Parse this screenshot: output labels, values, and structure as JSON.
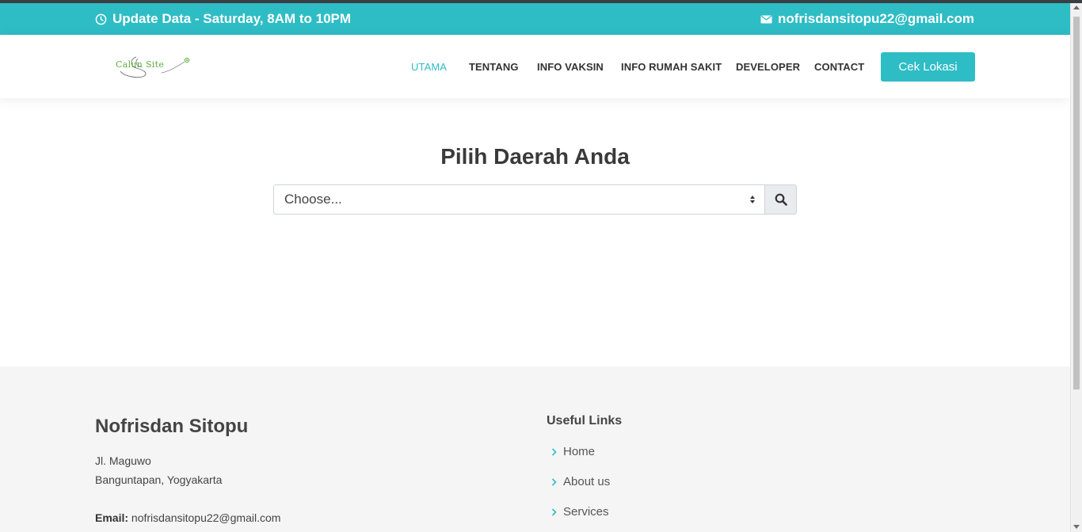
{
  "topbar": {
    "schedule": "Update Data - Saturday, 8AM to 10PM",
    "email": "nofrisdansitopu22@gmail.com",
    "clock_icon": "clock-icon",
    "mail_icon": "envelope-icon"
  },
  "header": {
    "logo_text": "Calun Site",
    "nav": [
      {
        "label": "UTAMA",
        "active": true
      },
      {
        "label": "TENTANG",
        "active": false
      },
      {
        "label": "INFO VAKSIN",
        "active": false
      },
      {
        "label": "INFO RUMAH SAKIT",
        "active": false
      },
      {
        "label": "DEVELOPER",
        "active": false
      },
      {
        "label": "CONTACT",
        "active": false
      }
    ],
    "cta_label": "Cek Lokasi"
  },
  "main": {
    "title": "Pilih Daerah Anda",
    "select_value": "Choose...",
    "search_icon": "search-icon"
  },
  "footer": {
    "name": "Nofrisdan Sitopu",
    "address_line1": "Jl. Maguwo",
    "address_line2": "Banguntapan, Yogyakarta",
    "email_label": "Email:",
    "email_value": "nofrisdansitopu22@gmail.com",
    "links_title": "Useful Links",
    "links": [
      "Home",
      "About us",
      "Services"
    ]
  },
  "colors": {
    "accent": "#2ebdc5",
    "footer_bg": "#f5f5f5",
    "text": "#444444"
  }
}
